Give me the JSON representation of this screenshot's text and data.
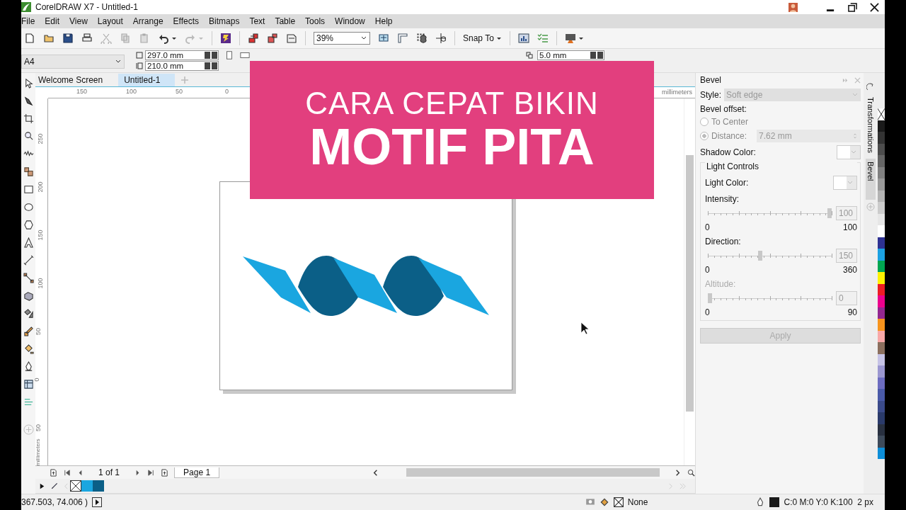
{
  "window": {
    "title": "CorelDRAW X7 - Untitled-1"
  },
  "menu": [
    "File",
    "Edit",
    "View",
    "Layout",
    "Arrange",
    "Effects",
    "Bitmaps",
    "Text",
    "Table",
    "Tools",
    "Window",
    "Help"
  ],
  "toolbar": {
    "zoom": "39%",
    "snap_to": "Snap To"
  },
  "property_bar": {
    "page_size": "A4",
    "width": "297.0 mm",
    "height": "210.0 mm",
    "nudge": "5.0 mm"
  },
  "document_tabs": [
    {
      "label": "Welcome Screen",
      "selected": false
    },
    {
      "label": "Untitled-1",
      "selected": true
    }
  ],
  "rulers": {
    "horizontal": [
      "150",
      "100",
      "50",
      "0"
    ],
    "horizontal_unit": "millimeters",
    "vertical": [
      "250",
      "200",
      "150",
      "100",
      "50",
      "0",
      "50"
    ],
    "vertical_unit": "millimeters"
  },
  "overlay_title": {
    "line_1": "CARA CEPAT BIKIN",
    "line_2": "MOTIF PITA"
  },
  "page_navigator": {
    "count": "1 of 1",
    "pages": [
      {
        "label": "Page 1",
        "selected": true
      }
    ]
  },
  "document_palette": [
    {
      "color": "#1aa6e0"
    },
    {
      "color": "#0b5f87"
    }
  ],
  "docker": {
    "title": "Bevel",
    "style_label": "Style:",
    "style": "Soft edge",
    "offset_label": "Bevel offset:",
    "offset_options": [
      {
        "label": "To Center",
        "selected": false
      },
      {
        "label": "Distance:",
        "selected": true
      }
    ],
    "distance": "7.62 mm",
    "shadow_color_label": "Shadow Color:",
    "light_controls": "Light Controls",
    "light_color_label": "Light Color:",
    "sliders": [
      {
        "label": "Intensity:",
        "value": "100",
        "min": "0",
        "max": "100",
        "level": 1,
        "disabled": false
      },
      {
        "label": "Direction:",
        "value": "150",
        "min": "0",
        "max": "360",
        "level": 0.42,
        "disabled": false
      },
      {
        "label": "Altitude:",
        "value": "0",
        "min": "0",
        "max": "90",
        "level": 0,
        "disabled": true
      }
    ],
    "apply": "Apply"
  },
  "docker_tabs": [
    {
      "label": "Transformations",
      "selected": false
    },
    {
      "label": "Bevel",
      "selected": true
    }
  ],
  "palette": [
    {
      "color": "#1a1a1a"
    },
    {
      "color": "#333333"
    },
    {
      "color": "#4d4d4d"
    },
    {
      "color": "#666666"
    },
    {
      "color": "#808080"
    },
    {
      "color": "#999999"
    },
    {
      "color": "#b3b3b3"
    },
    {
      "color": "#cccccc"
    },
    {
      "color": "#e6e6e6"
    },
    {
      "color": "#ffffff"
    },
    {
      "color": "#2e3192"
    },
    {
      "color": "#1ba1e2"
    },
    {
      "color": "#00a651"
    },
    {
      "color": "#fff200"
    },
    {
      "color": "#ed1c24"
    },
    {
      "color": "#ec008c"
    },
    {
      "color": "#92278f"
    },
    {
      "color": "#f7941d"
    },
    {
      "color": "#f9a9a9"
    },
    {
      "color": "#8b6f5e"
    },
    {
      "color": "#c6c3e6"
    },
    {
      "color": "#9b97d0"
    },
    {
      "color": "#6c6cc0"
    },
    {
      "color": "#4a5aa8"
    },
    {
      "color": "#3a4a8a"
    },
    {
      "color": "#2a3a6a"
    },
    {
      "color": "#283040"
    },
    {
      "color": "#3d4a5a"
    },
    {
      "color": "#0d8ed8"
    }
  ],
  "status_bar": {
    "coordinates": "367.503, 74.006 )",
    "fill": "None",
    "outline": "C:0 M:0 Y:0 K:100  2 px"
  }
}
